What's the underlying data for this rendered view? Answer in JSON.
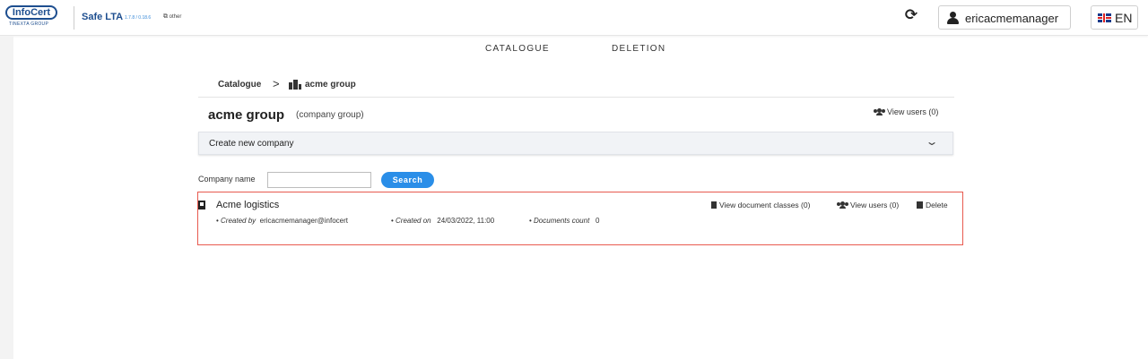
{
  "header": {
    "logo_text": "InfoCert",
    "logo_sub": "TINEXTA GROUP",
    "app_title": "Safe LTA",
    "app_version": "1.7.8 / 0.18.6",
    "other_link": "other",
    "user_name": "ericacmemanager",
    "language": "EN"
  },
  "nav": {
    "tabs": [
      {
        "label": "CATALOGUE"
      },
      {
        "label": "DELETION"
      }
    ]
  },
  "breadcrumb": {
    "root": "Catalogue",
    "current": "acme group"
  },
  "group": {
    "title": "acme group",
    "type": "(company group)",
    "view_users": "View users (0)"
  },
  "create_company": {
    "label": "Create new company"
  },
  "search": {
    "label": "Company name",
    "value": "",
    "placeholder": "",
    "button": "Search"
  },
  "companies": [
    {
      "name": "Acme logistics",
      "created_by_label": "Created by",
      "created_by": "ericacmemanager@infocert",
      "created_on_label": "Created on",
      "created_on": "24/03/2022, 11:00",
      "documents_count_label": "Documents count",
      "documents_count": "0",
      "view_document_classes": "View document classes (0)",
      "view_users": "View users (0)",
      "delete": "Delete"
    }
  ],
  "colors": {
    "brand": "#1d4e8f",
    "accent": "#2a8ee8",
    "highlight_border": "#e85a4f"
  }
}
